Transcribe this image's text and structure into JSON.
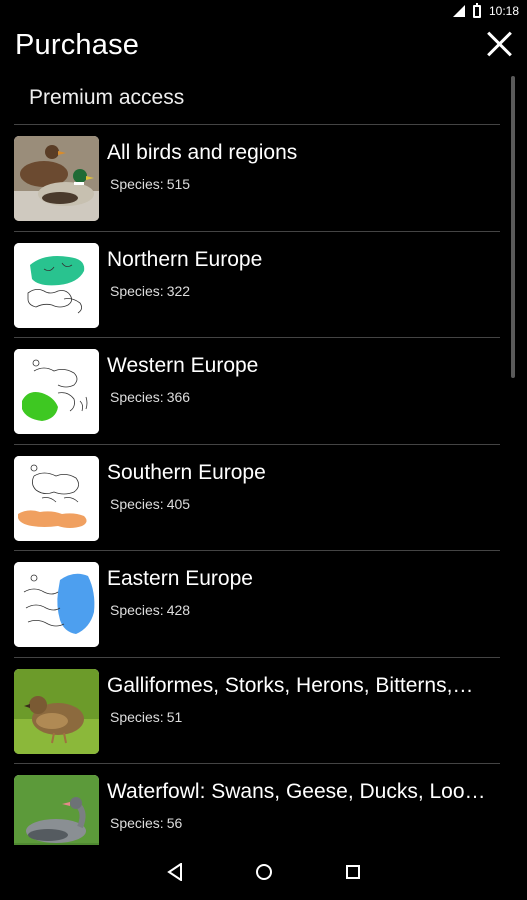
{
  "status_bar": {
    "time": "10:18"
  },
  "header": {
    "title": "Purchase"
  },
  "section": {
    "title": "Premium access"
  },
  "species_label": "Species:",
  "items": [
    {
      "name": "All birds and regions",
      "count": "515",
      "thumb": "mallard-duck-photo"
    },
    {
      "name": "Northern Europe",
      "count": "322",
      "thumb": "map-northern-europe",
      "highlight": "#29c38f"
    },
    {
      "name": "Western Europe",
      "count": "366",
      "thumb": "map-western-europe",
      "highlight": "#3ec822"
    },
    {
      "name": "Southern Europe",
      "count": "405",
      "thumb": "map-southern-europe",
      "highlight": "#f0a060"
    },
    {
      "name": "Eastern Europe",
      "count": "428",
      "thumb": "map-eastern-europe",
      "highlight": "#4d9fef"
    },
    {
      "name": "Galliformes, Storks, Herons, Bitterns,…",
      "count": "51",
      "thumb": "quail-photo"
    },
    {
      "name": "Waterfowl: Swans, Geese, Ducks, Loo…",
      "count": "56",
      "thumb": "goose-photo"
    }
  ]
}
